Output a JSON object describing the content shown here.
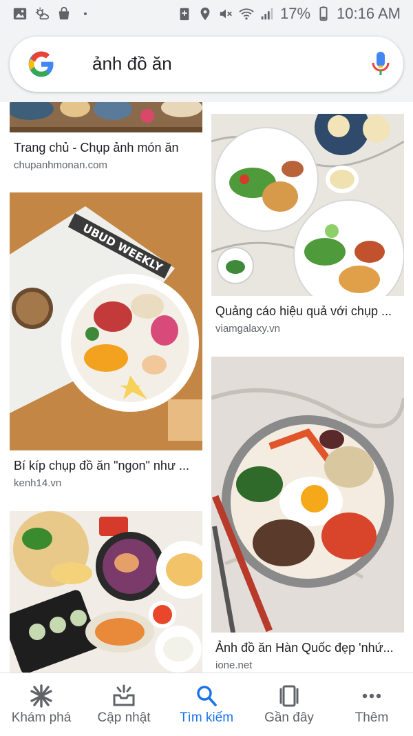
{
  "status_bar": {
    "battery": "17%",
    "time": "10:16 AM",
    "left_icons": [
      "image-icon",
      "weather-icon",
      "shopping-bag-icon"
    ],
    "right_icons": [
      "data-saver-icon",
      "location-icon",
      "mute-icon",
      "wifi-icon",
      "signal-icon",
      "battery-icon"
    ]
  },
  "search": {
    "query": "ảnh đồ ăn"
  },
  "results": [
    {
      "title": "Trang chủ - Chụp ảnh món ăn",
      "source": "chupanhmonan.com"
    },
    {
      "title": "Quảng cáo hiệu quả với chụp ...",
      "source": "viamgalaxy.vn"
    },
    {
      "title": "Bí kíp chụp đồ ăn \"ngon\" như ...",
      "source": "kenh14.vn",
      "image_text": "UBUD WEEKLY"
    },
    {
      "title": "Ảnh đồ ăn Hàn Quốc đẹp 'nhứ...",
      "source": "ione.net"
    },
    {
      "title": "",
      "source": ""
    }
  ],
  "bottom_nav": {
    "items": [
      {
        "label": "Khám phá",
        "icon": "asterisk-icon",
        "active": false
      },
      {
        "label": "Cập nhật",
        "icon": "inbox-updates-icon",
        "active": false
      },
      {
        "label": "Tìm kiếm",
        "icon": "search-icon",
        "active": true
      },
      {
        "label": "Gần đây",
        "icon": "recent-tabs-icon",
        "active": false
      },
      {
        "label": "Thêm",
        "icon": "more-dots-icon",
        "active": false
      }
    ]
  },
  "colors": {
    "accent": "#1a73e8",
    "secondary_text": "#5f6368",
    "google_blue": "#4285f4",
    "google_red": "#ea4335",
    "google_yellow": "#fbbc05",
    "google_green": "#34a853"
  }
}
